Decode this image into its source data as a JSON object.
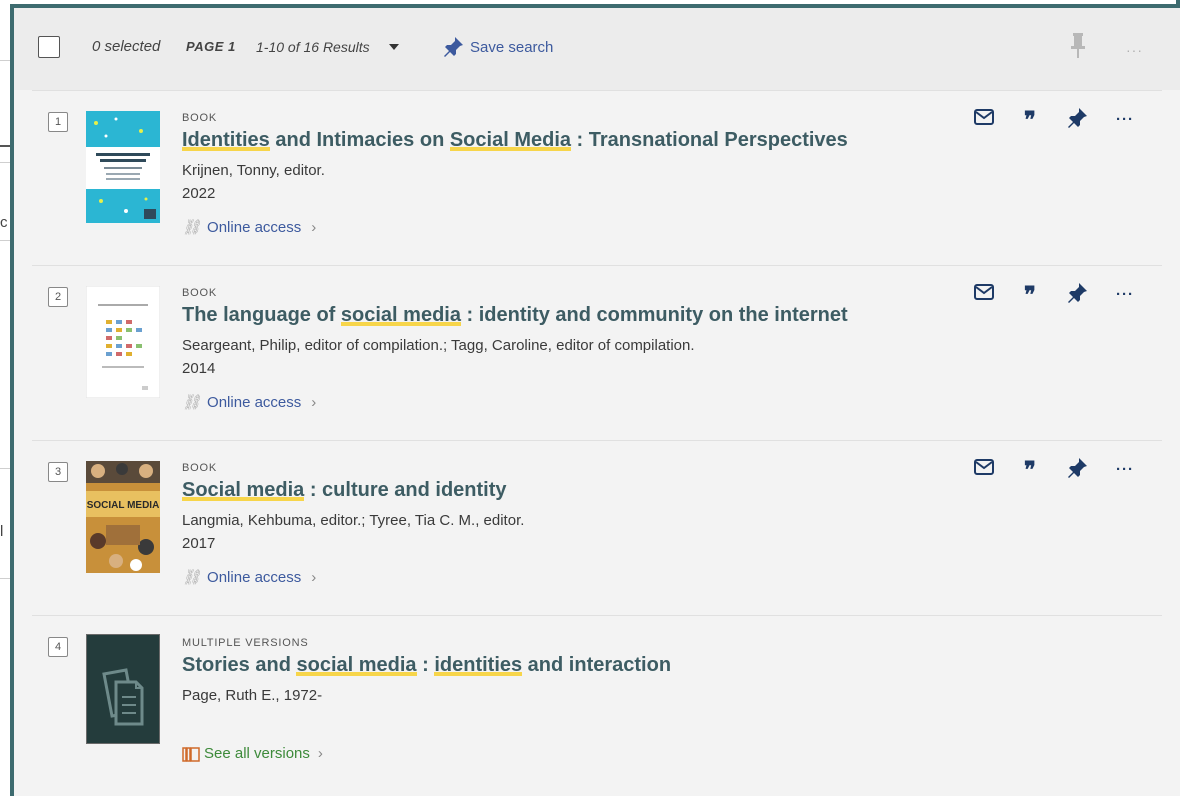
{
  "toolbar": {
    "selected": "0 selected",
    "page": "PAGE 1",
    "results": "1-10 of 16 Results",
    "save_search": "Save search",
    "more": "···"
  },
  "left_fragments": {
    "frag_a": "c",
    "frag_b": "l"
  },
  "results": [
    {
      "num": "1",
      "type": "BOOK",
      "title_parts": [
        "Identities",
        " and Intimacies on ",
        "Social Media",
        " : Transnational Perspectives"
      ],
      "author": "Krijnen, Tonny, editor.",
      "year": "2022",
      "access": "Online access"
    },
    {
      "num": "2",
      "type": "BOOK",
      "title_parts": [
        "The language of ",
        "social media",
        " : identity and community on the internet"
      ],
      "author": "Seargeant, Philip, editor of compilation.; Tagg, Caroline, editor of compilation.",
      "year": "2014",
      "access": "Online access"
    },
    {
      "num": "3",
      "type": "BOOK",
      "title_parts": [
        "Social media",
        " : culture and identity"
      ],
      "author": "Langmia, Kehbuma, editor.; Tyree, Tia C. M., editor.",
      "year": "2017",
      "access": "Online access",
      "thumb_text": "SOCIAL MEDIA"
    },
    {
      "num": "4",
      "type": "MULTIPLE VERSIONS",
      "title_parts": [
        "Stories and ",
        "social media",
        " : ",
        "identities",
        " and interaction"
      ],
      "author": "Page, Ruth E., 1972-",
      "versions": "See all versions"
    }
  ],
  "actions": {
    "quote": "❞",
    "more": "···"
  },
  "colors": {
    "accent": "#3d6b6f",
    "link": "#3d5a9e",
    "title": "#3d5c63",
    "icon": "#1e3a66",
    "highlight": "#f7d54a"
  }
}
